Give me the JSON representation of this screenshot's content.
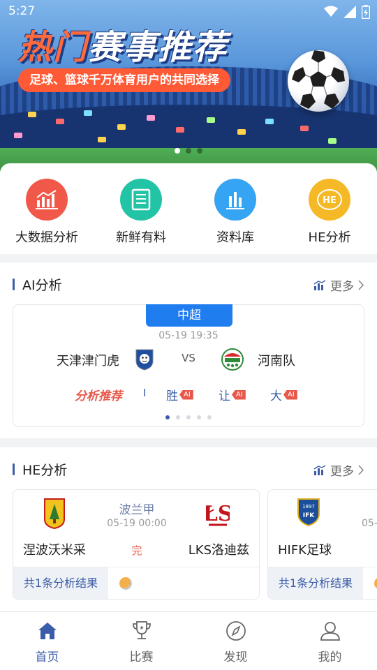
{
  "status_bar": {
    "time": "5:27"
  },
  "banner": {
    "title_highlight": "热门",
    "title_rest": "赛事推荐",
    "subtitle": "足球、篮球千万体育用户的共同选择",
    "page_count": 3,
    "active_page": 0
  },
  "quick_menu": [
    {
      "label": "大数据分析",
      "icon": "chart-icon",
      "color": "#f0594a"
    },
    {
      "label": "新鲜有料",
      "icon": "news-icon",
      "color": "#22c4a5"
    },
    {
      "label": "资料库",
      "icon": "bar-chart-icon",
      "color": "#35a4f2"
    },
    {
      "label": "HE分析",
      "icon": "he-badge-icon",
      "color": "#f5b928"
    }
  ],
  "ai_section": {
    "title": "AI分析",
    "more": "更多",
    "card": {
      "league": "中超",
      "time": "05-19 19:35",
      "home": "天津津门虎",
      "vs": "VS",
      "away": "河南队",
      "recommend_label": "分析推荐",
      "separator": "I",
      "items": [
        "胜",
        "让",
        "大"
      ],
      "ai_tag": "AI"
    },
    "page_count": 5,
    "active_page": 0
  },
  "he_section": {
    "title": "HE分析",
    "more": "更多",
    "cards": [
      {
        "league": "波兰甲",
        "time": "05-19 00:00",
        "home": "涅波沃米采",
        "status": "完",
        "away": "LKS洛迪兹",
        "footer": "共1条分析结果"
      },
      {
        "league": "",
        "time": "05-",
        "home": "HIFK足球",
        "status": "",
        "away": "",
        "footer": "共1条分析结果"
      }
    ]
  },
  "tabbar": [
    {
      "label": "首页",
      "icon": "home-icon",
      "active": true
    },
    {
      "label": "比赛",
      "icon": "trophy-icon",
      "active": false
    },
    {
      "label": "发现",
      "icon": "compass-icon",
      "active": false
    },
    {
      "label": "我的",
      "icon": "user-icon",
      "active": false
    }
  ],
  "colors": {
    "accent": "#3b5ca8",
    "league_blue": "#1f7df0",
    "red": "#e8584a"
  }
}
